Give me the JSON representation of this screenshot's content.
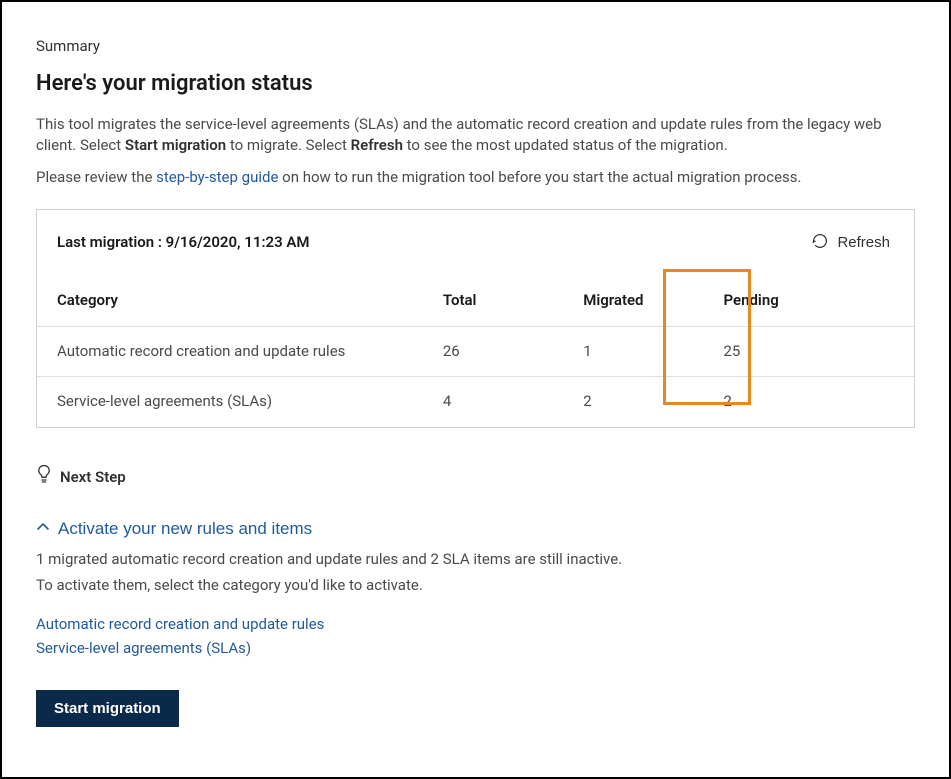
{
  "section_label": "Summary",
  "heading": "Here's your migration status",
  "intro_a": "This tool migrates the service-level agreements (SLAs) and the automatic record creation and update rules from the legacy web client. Select ",
  "intro_bold_a": "Start migration",
  "intro_b": " to migrate. Select ",
  "intro_bold_b": "Refresh",
  "intro_c": " to see the most updated status of the migration.",
  "review_a": "Please review the ",
  "review_link": "step-by-step guide",
  "review_b": " on how to run the migration tool before you start the actual migration process.",
  "panel": {
    "stamp_label": "Last migration : ",
    "stamp_value": "9/16/2020, 11:23 AM",
    "refresh_label": "Refresh",
    "columns": [
      "Category",
      "Total",
      "Migrated",
      "Pending"
    ],
    "rows": [
      {
        "category": "Automatic record creation and update rules",
        "total": "26",
        "migrated": "1",
        "pending": "25"
      },
      {
        "category": "Service-level agreements (SLAs)",
        "total": "4",
        "migrated": "2",
        "pending": "2"
      }
    ]
  },
  "next_step_label": "Next Step",
  "activate": {
    "title": "Activate your new rules and items",
    "line1": "1 migrated automatic record creation and update rules and 2 SLA items are still inactive.",
    "line2": "To activate them, select the category you'd like to activate.",
    "links": [
      "Automatic record creation and update rules",
      "Service-level agreements (SLAs)"
    ]
  },
  "cta_label": "Start migration"
}
